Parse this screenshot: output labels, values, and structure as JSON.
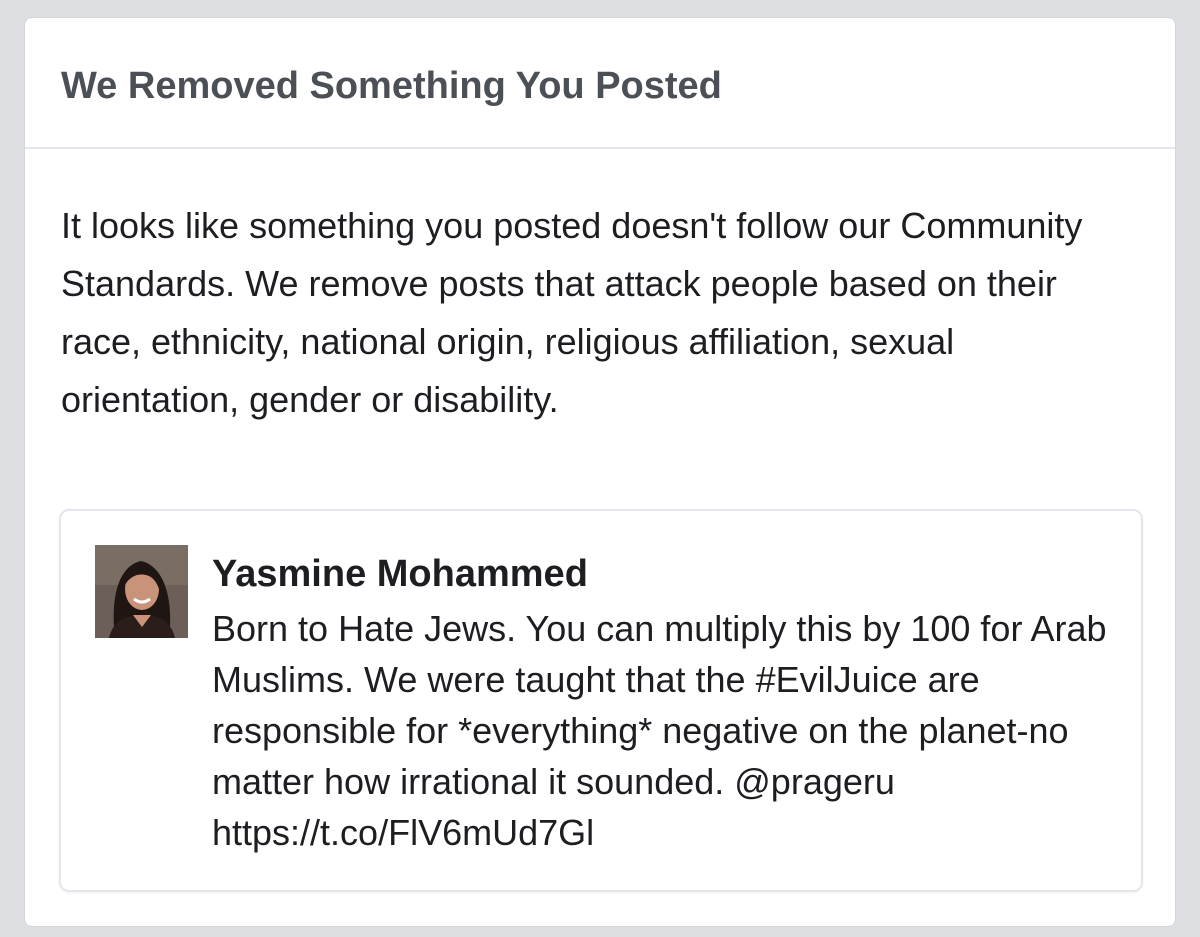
{
  "notice": {
    "title": "We Removed Something You Posted",
    "explanation": "It looks like something you posted doesn't follow our Community Standards. We remove posts that attack people based on their race, ethnicity, national origin, religious affiliation, sexual orientation, gender or disability."
  },
  "post": {
    "author": "Yasmine Mohammed",
    "avatar_icon": "user-avatar",
    "text": "Born to Hate Jews. You can multiply this by 100 for Arab Muslims. We were taught that the #EvilJuice are responsible for *everything* negative on the planet-no matter how irrational it sounded. @prageru https://t.co/FlV6mUd7Gl"
  },
  "colors": {
    "page_background": "#dddfe2",
    "card_background": "#ffffff",
    "title_text": "#4b4f56",
    "body_text": "#1c1e21",
    "divider": "#e4e6eb"
  }
}
